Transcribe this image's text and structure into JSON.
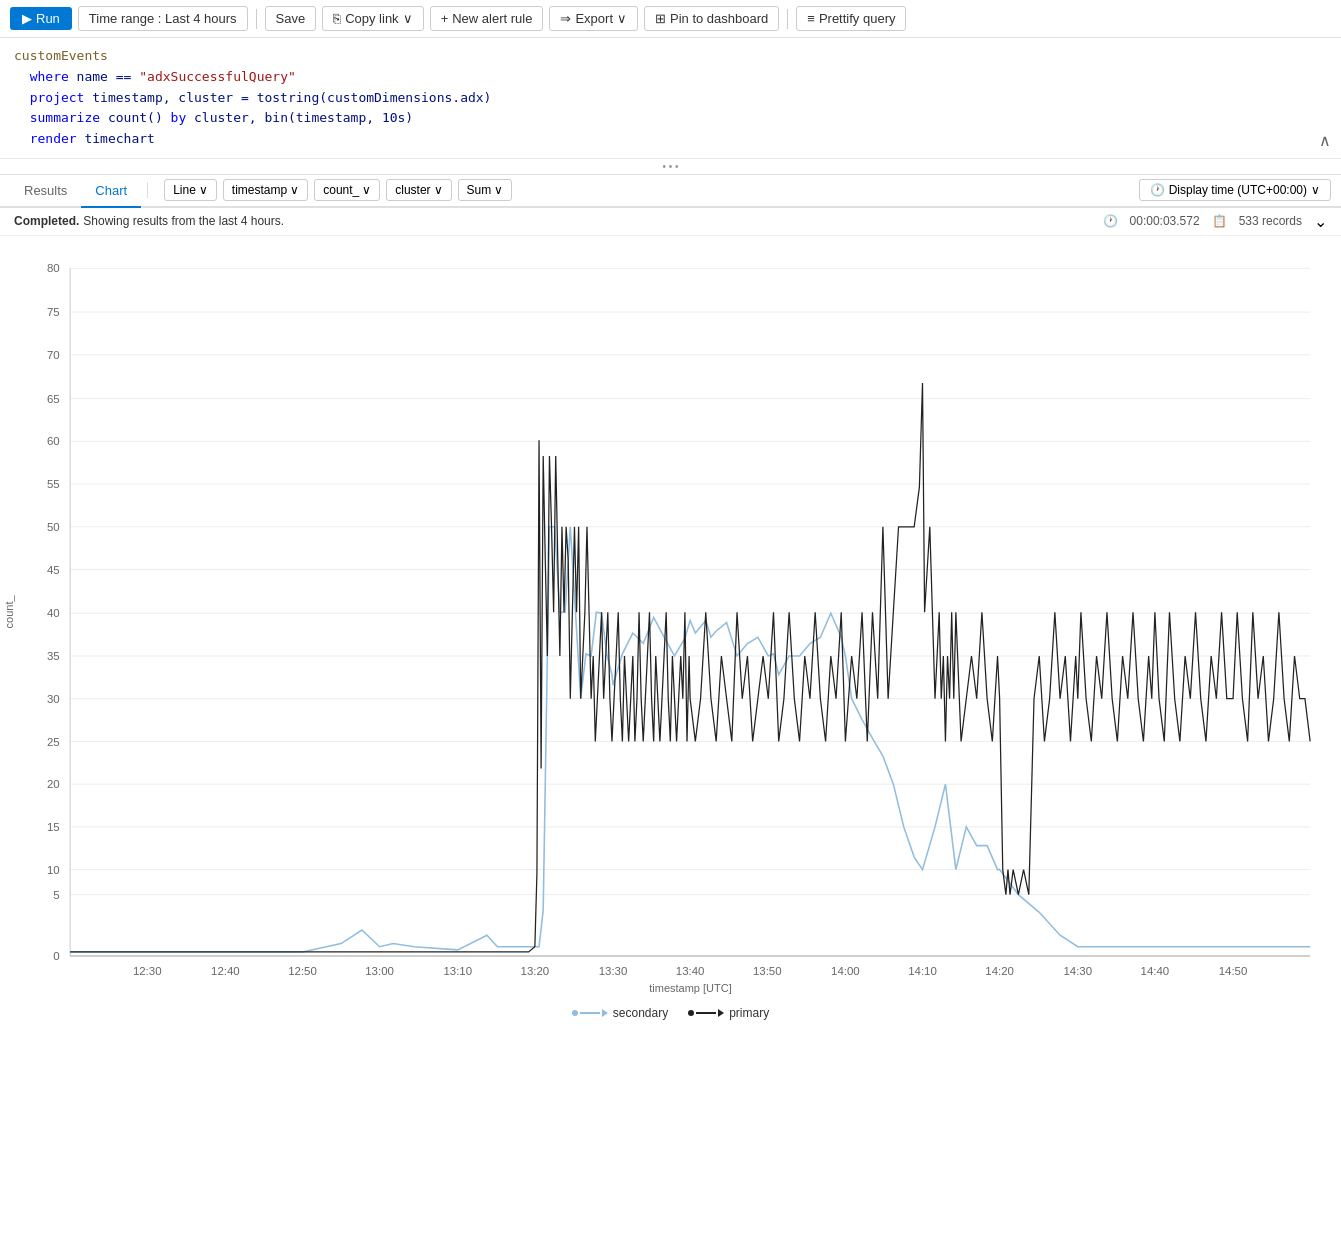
{
  "toolbar": {
    "run_label": "Run",
    "save_label": "Save",
    "copy_link_label": "Copy link",
    "new_alert_label": "New alert rule",
    "export_label": "Export",
    "pin_label": "Pin to dashboard",
    "prettify_label": "Prettify query",
    "time_range_label": "Time range : Last 4 hours"
  },
  "query": {
    "line1": "customEvents",
    "line2_kw": "where",
    "line2_rest": " name == ",
    "line2_str": "\"adxSuccessfulQuery\"",
    "line3_kw": "project",
    "line3_rest": " timestamp, cluster = tostring(customDimensions.adx)",
    "line4_kw": "summarize",
    "line4_rest": " count() ",
    "line4_by": "by",
    "line4_rest2": " cluster, bin(timestamp, 10s)",
    "line5_kw": "render",
    "line5_rest": " timechart"
  },
  "tabs": {
    "results_label": "Results",
    "chart_label": "Chart"
  },
  "chart_options": {
    "line_label": "Line",
    "timestamp_label": "timestamp",
    "count_label": "count_",
    "cluster_label": "cluster",
    "sum_label": "Sum",
    "display_time_label": "Display time (UTC+00:00)"
  },
  "status": {
    "completed_label": "Completed.",
    "showing_label": "Showing results from the last 4 hours.",
    "duration_label": "00:00:03.572",
    "records_label": "533 records",
    "expand_icon": "⌄"
  },
  "chart": {
    "y_label": "count_",
    "x_label": "timestamp [UTC]",
    "y_ticks": [
      "80",
      "75",
      "70",
      "65",
      "60",
      "55",
      "50",
      "45",
      "40",
      "35",
      "30",
      "25",
      "20",
      "15",
      "10",
      "5",
      "0"
    ],
    "x_ticks": [
      "12:30",
      "12:40",
      "12:50",
      "13:00",
      "13:10",
      "13:20",
      "13:30",
      "13:40",
      "13:50",
      "14:00",
      "14:10",
      "14:20",
      "14:30",
      "14:40",
      "14:50"
    ]
  },
  "legend": {
    "secondary_label": "secondary",
    "primary_label": "primary"
  },
  "icons": {
    "run_icon": "▶",
    "clock_icon": "🕐",
    "records_icon": "📋",
    "chevron_down": "∨",
    "dots": "...",
    "collapse": "^",
    "copy": "⎘",
    "plus": "+",
    "export_arrow": "→",
    "pin": "⊞",
    "lines": "≡"
  }
}
